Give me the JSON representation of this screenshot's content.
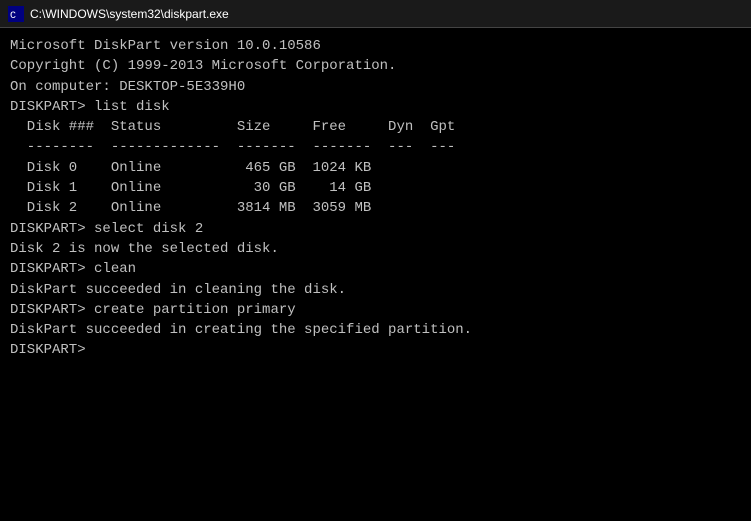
{
  "titlebar": {
    "label": "C:\\WINDOWS\\system32\\diskpart.exe"
  },
  "console": {
    "lines": [
      "Microsoft DiskPart version 10.0.10586",
      "",
      "Copyright (C) 1999-2013 Microsoft Corporation.",
      "On computer: DESKTOP-5E339H0",
      "",
      "DISKPART> list disk",
      "",
      "  Disk ###  Status         Size     Free     Dyn  Gpt",
      "  --------  -------------  -------  -------  ---  ---",
      "  Disk 0    Online          465 GB  1024 KB",
      "  Disk 1    Online           30 GB    14 GB",
      "  Disk 2    Online         3814 MB  3059 MB",
      "",
      "DISKPART> select disk 2",
      "",
      "Disk 2 is now the selected disk.",
      "",
      "DISKPART> clean",
      "",
      "DiskPart succeeded in cleaning the disk.",
      "",
      "DISKPART> create partition primary",
      "",
      "DiskPart succeeded in creating the specified partition.",
      "",
      "DISKPART> "
    ]
  }
}
